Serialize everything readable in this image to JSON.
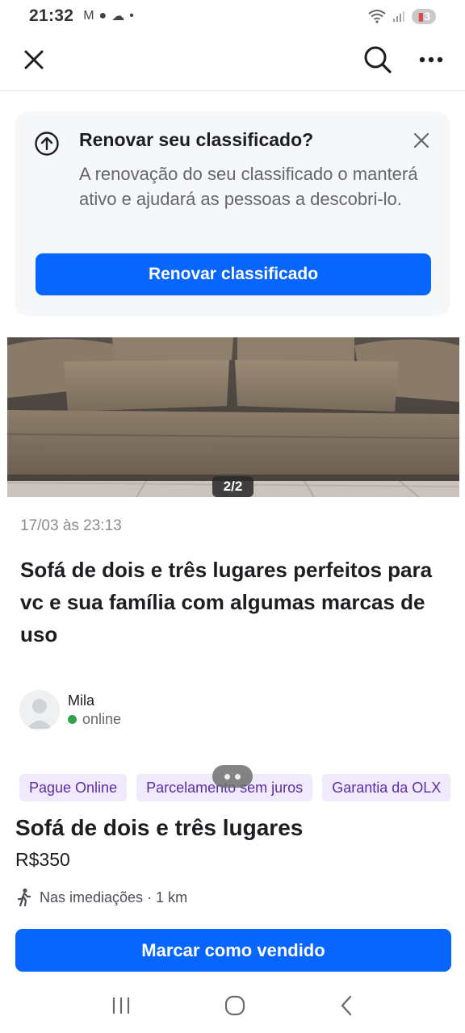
{
  "status_bar": {
    "time": "21:32",
    "battery": "3"
  },
  "renew_card": {
    "title": "Renovar seu classificado?",
    "description": "A renovação do seu classificado o manterá ativo e ajudará as pessoas a descobri-lo.",
    "button_label": "Renovar classificado"
  },
  "photo": {
    "counter": "2/2"
  },
  "post": {
    "date": "17/03 às 23:13",
    "title": "Sofá  de dois e três  lugares perfeitos para vc e sua família  com algumas marcas de uso"
  },
  "seller": {
    "name": "Mila",
    "status": "online"
  },
  "tags": [
    "Pague Online",
    "Parcelamento sem juros",
    "Garantia da OLX"
  ],
  "product": {
    "title": "Sofá  de dois e três  lugares",
    "price": "R$350",
    "location": "Nas imediações · 1 km"
  },
  "actions": {
    "mark_sold_label": "Marcar como vendido"
  },
  "colors": {
    "accent": "#0866ff",
    "tag_bg": "#f1eafd",
    "tag_text": "#5a2ea6",
    "online": "#31a24c"
  }
}
